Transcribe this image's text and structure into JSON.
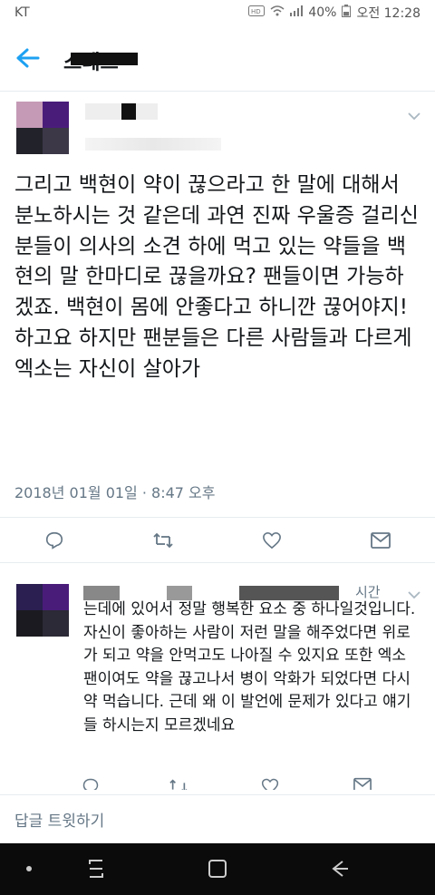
{
  "status_bar": {
    "carrier": "KT",
    "battery": "40%",
    "time": "오전 12:28",
    "icons": [
      "hd-voice-icon",
      "wifi-icon",
      "signal-icon",
      "battery-icon"
    ]
  },
  "header": {
    "title": "스레드",
    "back_icon": "back-arrow-icon"
  },
  "tweet": {
    "text": "그리고 백현이 약이 끊으라고 한 말에 대해서 분노하시는 것 같은데 과연 진짜 우울증 걸리신 분들이 의사의 소견 하에 먹고 있는 약들을 백현의 말 한마디로 끊을까요? 팬들이면 가능하겠죠. 백현이 몸에 안좋다고 하니깐 끊어야지!하고요 하지만 팬분들은 다른 사람들과 다르게 엑소는 자신이 살아가",
    "timestamp": "2018년 01월 01일 · 8:47 오후",
    "actions": [
      "reply-icon",
      "retweet-icon",
      "like-icon",
      "message-icon"
    ]
  },
  "reply": {
    "time": "시간",
    "text": "는데에 있어서 정말 행복한 요소 중 하나일것입니다. 자신이 좋아하는 사람이 저런 말을 해주었다면 위로가 되고 약을 안먹고도 나아질 수 있지요 또한 엑소 팬이여도 약을 끊고나서 병이 악화가 되었다면 다시 약 먹습니다. 근데 왜 이 발언에 문제가 있다고 얘기들 하시는지 모르겠네요"
  },
  "reply_bar": {
    "placeholder": "답글 트윗하기"
  },
  "colors": {
    "accent": "#1da1f2",
    "text": "#14171a",
    "muted": "#657786",
    "divider": "#e6ecf0",
    "navbar": "#0b0b0b"
  }
}
